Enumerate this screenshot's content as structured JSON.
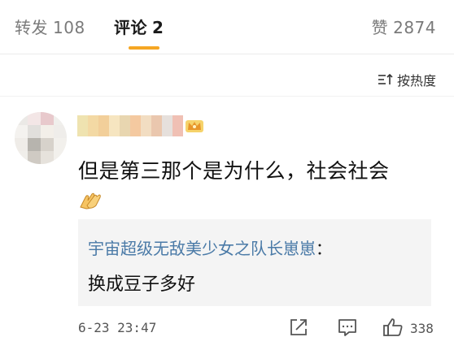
{
  "tabs": {
    "repost": {
      "label": "转发",
      "count": "108"
    },
    "comment": {
      "label": "评论",
      "count": "2"
    },
    "like": {
      "label": "赞",
      "count": "2874"
    }
  },
  "sort": {
    "label": "按热度"
  },
  "comment": {
    "text": "但是第三那个是为什么，社会社会",
    "reply": {
      "author": "宇宙超级无敌美少女之队长崽崽",
      "separator": "：",
      "text": "换成豆子多好"
    },
    "timestamp": "6-23 23:47",
    "like_count": "338"
  },
  "colors": {
    "accent": "#f5a623",
    "link": "#4a7aa7",
    "reply_bg": "#f4f4f4"
  },
  "icons": [
    "sort-icon",
    "crown-icon",
    "ok-hand-emoji",
    "share-icon",
    "reply-icon",
    "thumbs-up-icon"
  ]
}
